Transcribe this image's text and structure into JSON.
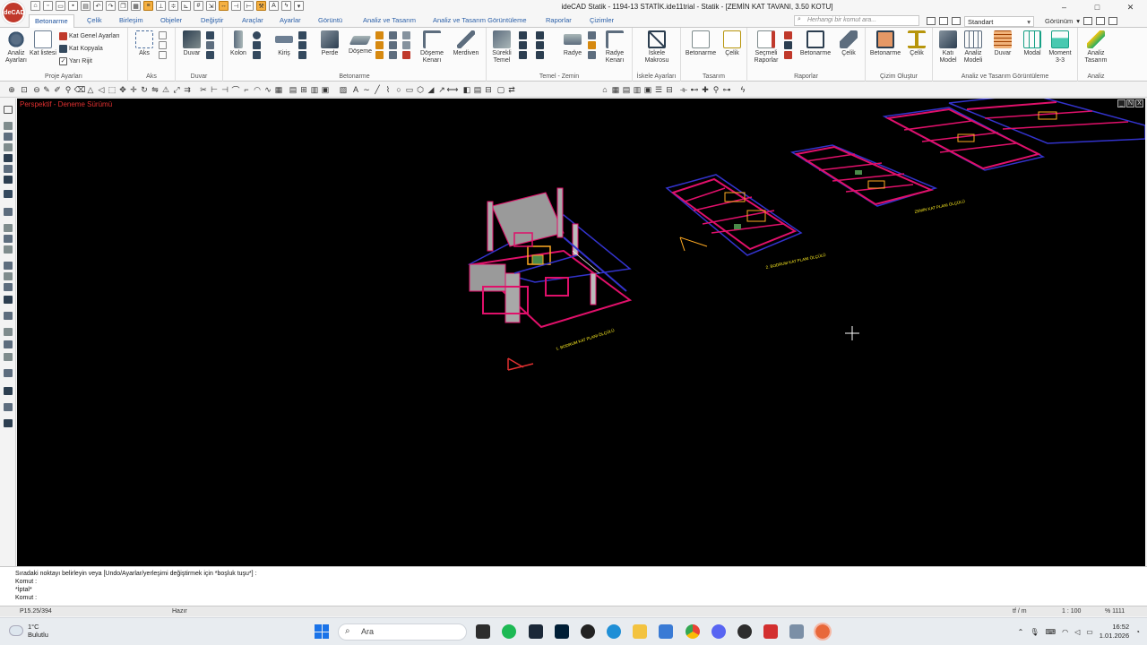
{
  "window": {
    "title": "ideCAD Statik - 1194-13 STATİK.ide11trial - Statik - [ZEMİN KAT TAVANI,  3.50 KOTU]",
    "logo_text": "ideCAD",
    "controls": [
      "–",
      "□",
      "✕"
    ]
  },
  "tabs": [
    "Betonarme",
    "Çelik",
    "Birleşim",
    "Objeler",
    "Değiştir",
    "Araçlar",
    "Ayarlar",
    "Görüntü",
    "Analiz ve Tasarım",
    "Analiz ve Tasarım Görüntüleme",
    "Raporlar",
    "Çizimler"
  ],
  "active_tab": "Betonarme",
  "search": {
    "placeholder": "Herhangi bir komut ara..."
  },
  "style_combo": "Standart",
  "view_menu": "Görünüm",
  "ribbon": {
    "proje": {
      "label": "Proje Ayarları",
      "analiz_ayarlari": "Analiz Ayarları",
      "kat_listesi": "Kat listesi",
      "kat_genel": "Kat Genel Ayarları",
      "kat_kopyala": "Kat Kopyala",
      "yari_rijit": "Yarı Rijit"
    },
    "aks": {
      "label": "Aks",
      "aks": "Aks"
    },
    "duvar": {
      "label": "Duvar",
      "duvar": "Duvar"
    },
    "betonarme": {
      "label": "Betonarme",
      "kolon": "Kolon",
      "kiris": "Kiriş",
      "perde": "Perde",
      "doseme": "Döşeme",
      "doseme_kenari": "Döşeme Kenarı",
      "merdiven": "Merdiven"
    },
    "temel": {
      "label": "Temel - Zemin",
      "surekli": "Sürekli Temel",
      "radye": "Radye",
      "radye_kenari": "Radye Kenarı"
    },
    "iskele": {
      "label": "İskele Ayarları",
      "iskele": "İskele Makrosu"
    },
    "tasarim": {
      "label": "Tasarım",
      "betonarme": "Betonarme",
      "celik": "Çelik"
    },
    "raporlar": {
      "label": "Raporlar",
      "secmeli": "Seçmeli Raporlar",
      "betonarme": "Betonarme",
      "celik": "Çelik"
    },
    "cizim": {
      "label": "Çizim Oluştur",
      "betonarme": "Betonarme",
      "celik": "Çelik"
    },
    "goruntu": {
      "label": "Analiz ve Tasarım Görüntüleme",
      "kat_model": "Katı Model",
      "analiz_modeli": "Analiz Modeli",
      "duvar": "Duvar",
      "modal": "Modal",
      "moment": "Moment 3-3"
    },
    "analiz": {
      "label": "Analiz",
      "analiz_tasarim": "Analiz Tasarım"
    }
  },
  "canvas": {
    "watermark": "Perspektif - Deneme Sürümü",
    "plan_label_1": "1. BODRUM KAT PLANI ÖLÇÜLÜ",
    "plan_label_2": "2. BODRUM KAT PLANI ÖLÇÜLÜ",
    "plan_label_3": "ZEMİN KAT PLANI ÖLÇÜLÜ",
    "view_buttons": [
      "_",
      "N",
      "X"
    ]
  },
  "command": {
    "prompt": "Sıradaki noktayı belirleyin veya [Undo/Ayarlar/yerleşimi değiştirmek için *boşluk tuşu*] :",
    "lines": [
      "Komut :",
      "*İptal*",
      "Komut :"
    ]
  },
  "status": {
    "coords": "P15.25/394",
    "state": "Hazır",
    "unit": "tf / m",
    "scale": "1 : 100",
    "zoom": "% 1111"
  },
  "taskbar": {
    "temperature": "1°C",
    "weather": "Bulutlu",
    "search": "Ara",
    "time": "16:52",
    "date": "1.01.2026"
  }
}
